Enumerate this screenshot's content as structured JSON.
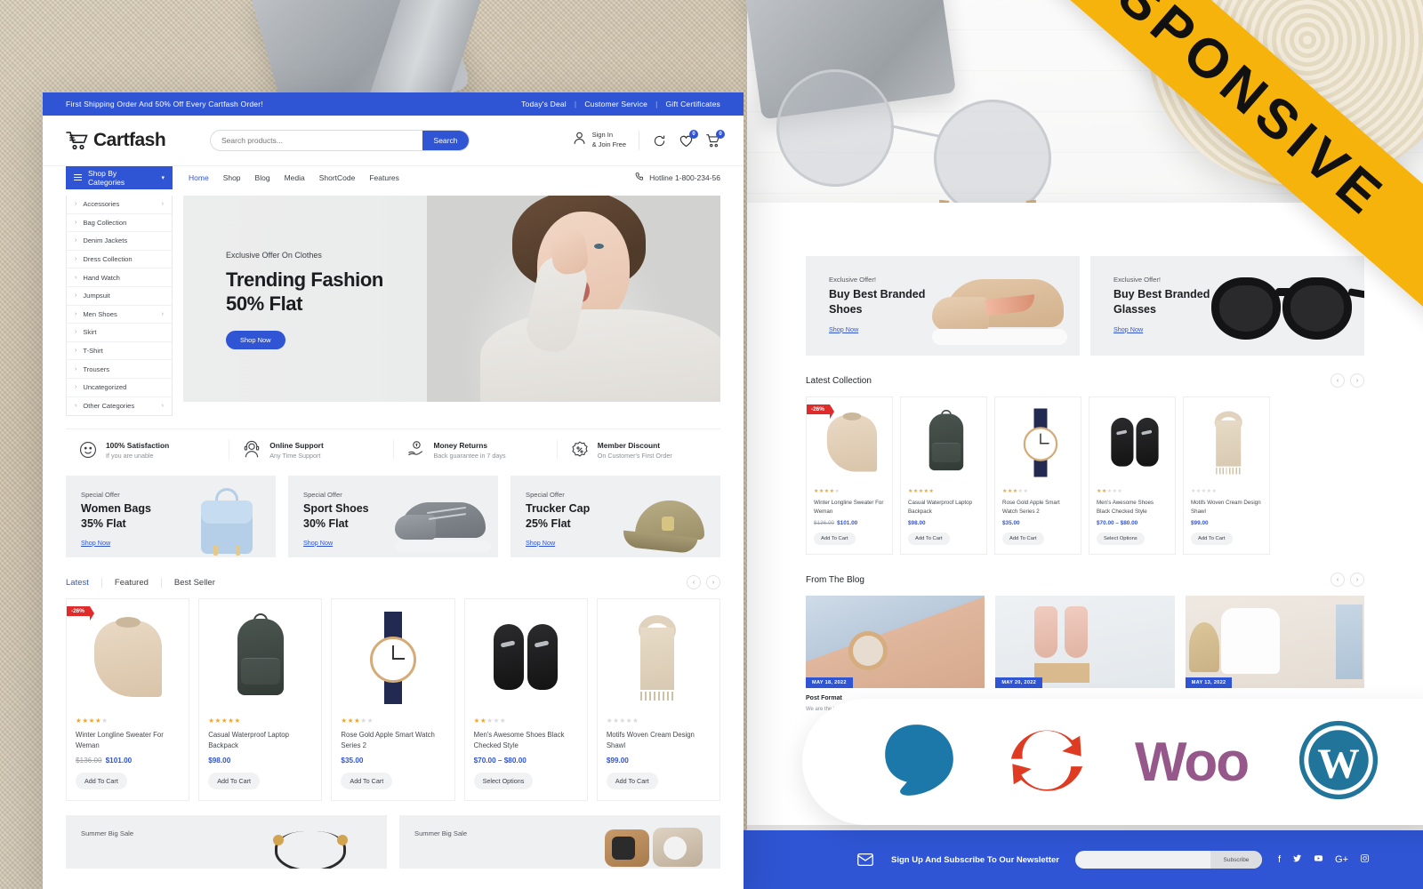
{
  "ribbon": {
    "label": "RESPONSIVE"
  },
  "topbar": {
    "promo": "First Shipping Order And 50% Off Every Cartfash Order!",
    "links": [
      "Today's Deal",
      "Customer Service",
      "Gift Certificates"
    ],
    "separator": "|"
  },
  "header": {
    "brand": "Cartfash",
    "search": {
      "placeholder": "Search products...",
      "value": "",
      "button": "Search"
    },
    "account": {
      "line1": "Sign In",
      "line2": "& Join Free"
    },
    "icons": {
      "compare": "compare-icon",
      "wishlist": "heart-icon",
      "cart": "cart-icon"
    },
    "wishlist_count": "0",
    "cart_count": "0"
  },
  "nav": {
    "categories_button": "Shop By Categories",
    "links": [
      "Home",
      "Shop",
      "Blog",
      "Media",
      "ShortCode",
      "Features"
    ],
    "active": "Home",
    "hotline": "Hotline 1-800-234-56"
  },
  "categories": [
    {
      "label": "Accessories",
      "has_sub": true
    },
    {
      "label": "Bag Collection",
      "has_sub": false
    },
    {
      "label": "Denim Jackets",
      "has_sub": false
    },
    {
      "label": "Dress Collection",
      "has_sub": false
    },
    {
      "label": "Hand Watch",
      "has_sub": false
    },
    {
      "label": "Jumpsuit",
      "has_sub": false
    },
    {
      "label": "Men Shoes",
      "has_sub": true
    },
    {
      "label": "Skirt",
      "has_sub": false
    },
    {
      "label": "T-Shirt",
      "has_sub": false
    },
    {
      "label": "Trousers",
      "has_sub": false
    },
    {
      "label": "Uncategorized",
      "has_sub": false
    },
    {
      "label": "Other Categories",
      "has_sub": true
    }
  ],
  "hero": {
    "subtitle": "Exclusive Offer On Clothes",
    "title_line1": "Trending Fashion",
    "title_line2": "50% Flat",
    "cta": "Shop Now"
  },
  "services": [
    {
      "title": "100% Satisfaction",
      "subtitle": "If you are unable",
      "icon": "smile-icon"
    },
    {
      "title": "Online Support",
      "subtitle": "Any Time Support",
      "icon": "headset-agent-icon"
    },
    {
      "title": "Money Returns",
      "subtitle": "Back guarantee in 7 days",
      "icon": "hand-coin-icon"
    },
    {
      "title": "Member Discount",
      "subtitle": "On Customer's First Order",
      "icon": "percent-badge-icon"
    }
  ],
  "offers": [
    {
      "sub": "Special Offer",
      "line1": "Women Bags",
      "line2": "35% Flat",
      "link": "Shop Now",
      "art": "bag"
    },
    {
      "sub": "Special Offer",
      "line1": "Sport Shoes",
      "line2": "30% Flat",
      "link": "Shop Now",
      "art": "shoe"
    },
    {
      "sub": "Special Offer",
      "line1": "Trucker Cap",
      "line2": "25% Flat",
      "link": "Shop Now",
      "art": "cap"
    }
  ],
  "product_tabs": {
    "items": [
      "Latest",
      "Featured",
      "Best Seller"
    ],
    "active": "Latest"
  },
  "products": [
    {
      "name": "Winter Longline Sweater For Weman",
      "price": "$101.00",
      "old_price": "$136.00",
      "rating": 4,
      "button": "Add To Cart",
      "badge": "-26%",
      "art": "sweater"
    },
    {
      "name": "Casual Waterproof Laptop Backpack",
      "price": "$98.00",
      "old_price": "",
      "rating": 5,
      "button": "Add To Cart",
      "badge": "",
      "art": "backpack"
    },
    {
      "name": "Rose Gold Apple Smart Watch Series 2",
      "price": "$35.00",
      "old_price": "",
      "rating": 3,
      "button": "Add To Cart",
      "badge": "",
      "art": "watch"
    },
    {
      "name": "Men's Awesome Shoes Black Checked Style",
      "price": "$70.00 – $80.00",
      "old_price": "",
      "rating": 2,
      "button": "Select Options",
      "badge": "",
      "art": "shoes"
    },
    {
      "name": "Motifs Woven Cream Design Shawl",
      "price": "$99.00",
      "old_price": "",
      "rating": 0,
      "button": "Add To Cart",
      "badge": "",
      "art": "scarf"
    }
  ],
  "bottom_banners": [
    {
      "sub": "Summer Big Sale"
    },
    {
      "sub": "Summer Big Sale"
    }
  ],
  "right_banners": [
    {
      "sub": "Exclusive Offer!",
      "line1": "Buy Best Branded",
      "line2": "Shoes",
      "link": "Shop Now",
      "art": "sneaker"
    },
    {
      "sub": "Exclusive Offer!",
      "line1": "Buy Best Branded",
      "line2": "Glasses",
      "link": "Shop Now",
      "art": "sunglasses"
    }
  ],
  "latest_collection": {
    "title": "Latest Collection"
  },
  "blog_section": {
    "title": "From The Blog"
  },
  "blog_posts": [
    {
      "date": "MAY 18, 2022",
      "title": "Post Format",
      "excerpt": "We are the best in…",
      "art": "watch-photo"
    },
    {
      "date": "MAY 20, 2022",
      "title": "",
      "excerpt": "",
      "art": "heels-photo"
    },
    {
      "date": "MAY 13, 2022",
      "title": "",
      "excerpt": "",
      "art": "hoodie-photo"
    }
  ],
  "newsletter": {
    "title": "Sign Up And Subscribe To Our Newsletter",
    "placeholder": "",
    "value": "",
    "button": "Subscribe",
    "socials": [
      "facebook-icon",
      "twitter-icon",
      "youtube-icon",
      "google-plus-icon",
      "instagram-icon"
    ]
  },
  "tech_badges": [
    {
      "name": "elementor-icon",
      "color": "#1b78a8"
    },
    {
      "name": "revolution-slider-icon",
      "color": "#df3b22"
    },
    {
      "name": "woocommerce-icon",
      "color": "#96588a",
      "label": "Woo"
    },
    {
      "name": "wordpress-icon",
      "color": "#21759b"
    }
  ],
  "colors": {
    "brand_blue": "#2f55d4",
    "ribbon_yellow": "#f5b30c",
    "sale_red": "#e02b2b",
    "star_gold": "#f5a623"
  }
}
